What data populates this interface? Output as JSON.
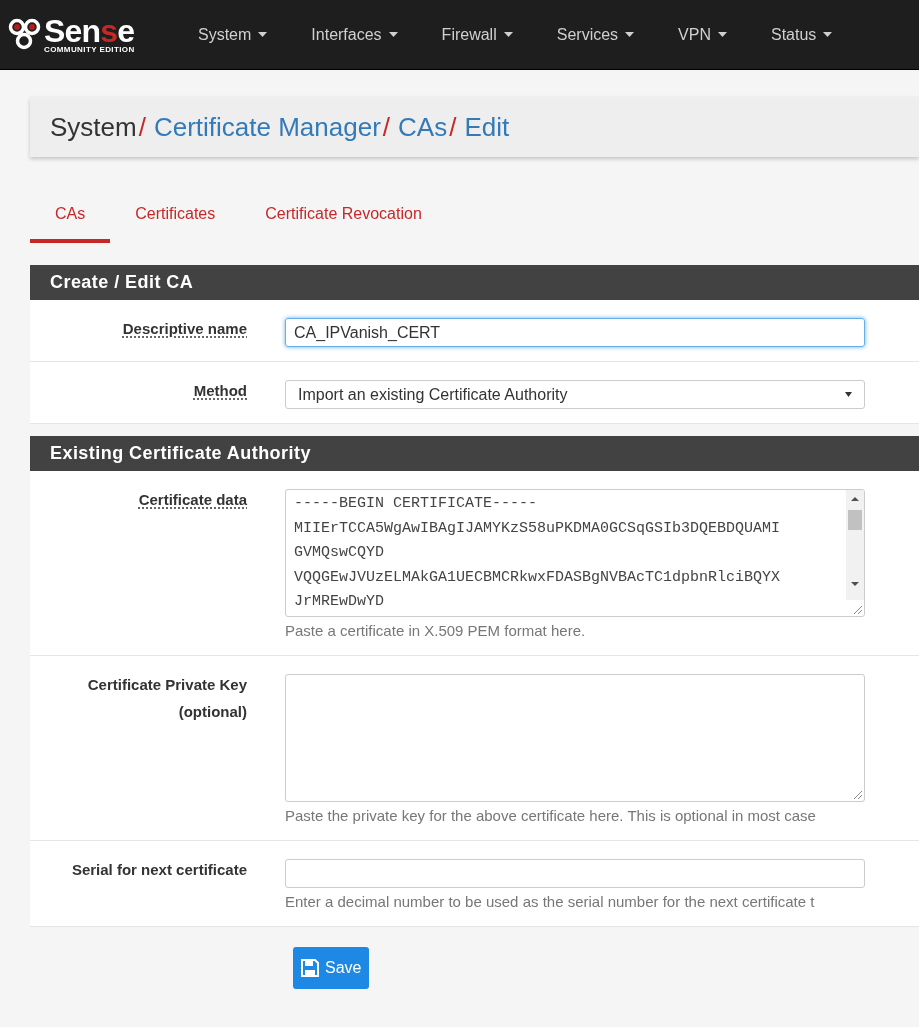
{
  "logo": {
    "parts": [
      {
        "text": "Sen",
        "accent": false
      },
      {
        "text": "s",
        "accent": true
      },
      {
        "text": "e",
        "accent": false
      }
    ],
    "subtitle": "COMMUNITY EDITION"
  },
  "nav": [
    {
      "label": "System"
    },
    {
      "label": "Interfaces"
    },
    {
      "label": "Firewall"
    },
    {
      "label": "Services"
    },
    {
      "label": "VPN"
    },
    {
      "label": "Status"
    }
  ],
  "breadcrumb_separator": "/",
  "breadcrumb": [
    {
      "label": "System",
      "link": false
    },
    {
      "label": "Certificate Manager",
      "link": true
    },
    {
      "label": "CAs",
      "link": true
    },
    {
      "label": "Edit",
      "link": true
    }
  ],
  "tabs": [
    {
      "label": "CAs",
      "selected": true
    },
    {
      "label": "Certificates",
      "selected": false
    },
    {
      "label": "Certificate Revocation",
      "selected": false
    }
  ],
  "sections": [
    {
      "title": "Create / Edit CA",
      "rows": [
        {
          "kind": "input",
          "label": "Descriptive name",
          "underlined": true,
          "value": "CA_IPVanish_CERT",
          "focused": true
        },
        {
          "kind": "select",
          "label": "Method",
          "underlined": true,
          "value": "Import an existing Certificate Authority"
        }
      ]
    },
    {
      "title": "Existing Certificate Authority",
      "rows": [
        {
          "kind": "textarea",
          "label": "Certificate data",
          "underlined": true,
          "lines": [
            "-----BEGIN CERTIFICATE-----",
            "MIIErTCCA5WgAwIBAgIJAMYKzS58uPKDMA0GCSqGSIb3DQEBDQUAMI",
            "GVMQswCQYD",
            "VQQGEwJVUzELMAkGA1UECBMCRkwxFDASBgNVBAcTC1dpbnRlciBQYX",
            "JrMREwDwYD"
          ],
          "help": "Paste a certificate in X.509 PEM format here."
        },
        {
          "kind": "textarea",
          "label": "Certificate Private Key",
          "sublabel": "(optional)",
          "underlined": false,
          "lines": [],
          "help": "Paste the private key for the above certificate here. This is optional in most case"
        },
        {
          "kind": "input",
          "label": "Serial for next certificate",
          "underlined": false,
          "value": "",
          "focused": false,
          "help": "Enter a decimal number to be used as the serial number for the next certificate t"
        }
      ]
    }
  ],
  "save_button": "Save"
}
